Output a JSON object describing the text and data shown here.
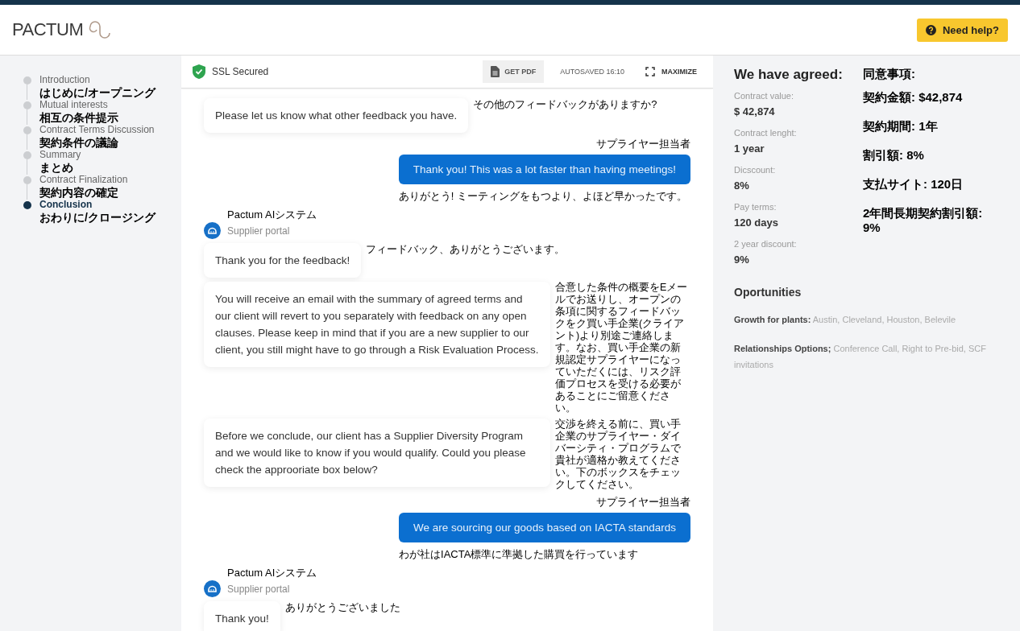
{
  "header": {
    "logo": "PACTUM",
    "help_button": "Need help?"
  },
  "sidebar": {
    "steps": [
      {
        "label": "Introduction",
        "note": "はじめに/オープニング",
        "selected": false
      },
      {
        "label": "Mutual interests",
        "note": "相互の条件提示",
        "selected": false
      },
      {
        "label": "Contract Terms Discussion",
        "note": "契約条件の議論",
        "selected": false
      },
      {
        "label": "Summary",
        "note": "まとめ",
        "selected": false
      },
      {
        "label": "Contract Finalization",
        "note": "契約内容の確定",
        "selected": false
      },
      {
        "label": "Conclusion",
        "note": "おわりに/クロージング",
        "selected": true
      }
    ]
  },
  "chat_toolbar": {
    "ssl": "SSL Secured",
    "pdf_button": "GET PDF",
    "autosaved": "AUTOSAVED 16:10",
    "maximize": "MAXIMIZE"
  },
  "messages": [
    {
      "kind": "agent",
      "text": "Please let us know what other feedback you have.",
      "note": "その他のフィードバックがありますか?"
    },
    {
      "kind": "user",
      "label": "サプライヤー担当者",
      "text": "Thank you! This was a lot faster than having meetings!",
      "note": "ありがとう! ミーティングをもつより、よほど早かったです。"
    },
    {
      "kind": "sender",
      "name": "Pactum AIシステム",
      "portal": "Supplier portal"
    },
    {
      "kind": "agent",
      "text": "Thank you for the feedback!",
      "note": "フィードバック、ありがとうございます。"
    },
    {
      "kind": "agent",
      "text": "You will receive an email with the summary of agreed terms and our client will revert to you separately with feedback on any open clauses. Please keep in mind that if you are a new supplier to our client, you still might have to go through a Risk Evaluation Process.",
      "note": "合意した条件の概要をEメールでお送りし、オープンの条項に関するフィードバックをク買い手企業(クライアント)より別途ご連絡します。なお、買い手企業の新規認定サプライヤーになっていただくには、リスク評価プロセスを受ける必要があることにご留意ください。"
    },
    {
      "kind": "agent",
      "text": "Before we conclude, our client has a Supplier Diversity Program and we would like to know if you would qualify. Could you please check the approoriate box below?",
      "note": "交渉を終える前に、買い手企業のサプライヤー・ダイバーシティ・プログラムで貴社が適格か教えてください。下のボックスをチェックしてください。"
    },
    {
      "kind": "user",
      "label": "サプライヤー担当者",
      "text": "We are sourcing our goods based on IACTA standards",
      "note": "わが社はIACTA標準に準拠した購買を行っています"
    },
    {
      "kind": "sender",
      "name": "Pactum AIシステム",
      "portal": "Supplier portal"
    },
    {
      "kind": "agent",
      "text": "Thank you!",
      "note": "ありがとうございました"
    }
  ],
  "agreed": {
    "title": "We have agreed:",
    "title_note": "同意事項:",
    "terms": [
      {
        "label": "Contract value:",
        "value": "$ 42,874"
      },
      {
        "label": "Contract lenght:",
        "value": "1 year"
      },
      {
        "label": "Dicscount:",
        "value": "8%"
      },
      {
        "label": "Pay terms:",
        "value": "120 days"
      },
      {
        "label": "2 year discount:",
        "value": "9%"
      }
    ],
    "notes": [
      "契約金額: $42,874",
      "契約期間: 1年",
      "割引額: 8%",
      "支払サイト: 120日",
      "2年間長期契約割引額: 9%"
    ]
  },
  "opportunities": {
    "title": "Oportunities",
    "items": [
      {
        "label": "Growth for plants:",
        "value": "Austin, Cleveland, Houston, Belevile"
      },
      {
        "label": "Relationships Options;",
        "value": "Conference Call, Right to Pre-bid, SCF invitations"
      }
    ]
  }
}
